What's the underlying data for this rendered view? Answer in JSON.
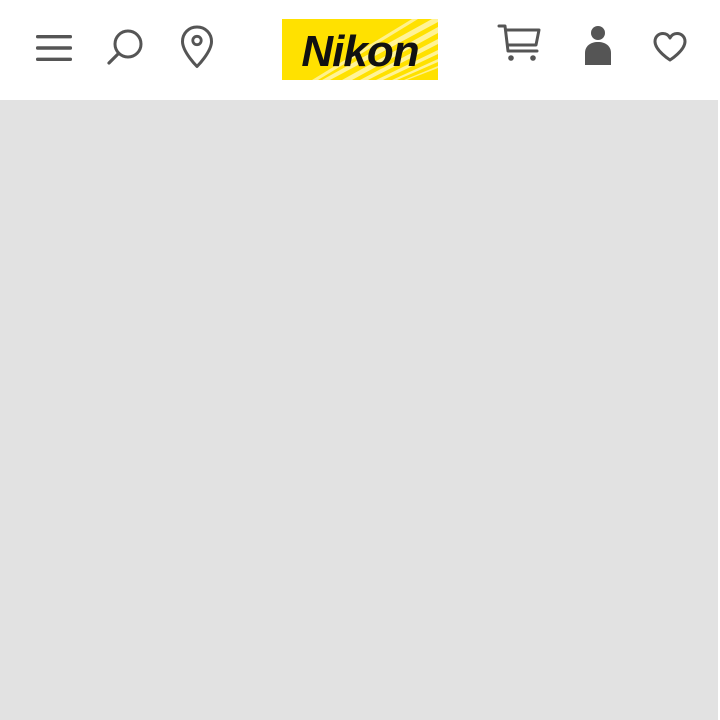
{
  "header": {
    "logo": {
      "text": "Nikon",
      "background_color": "#ffe100",
      "text_color": "#111111"
    },
    "icons": {
      "menu": "menu-icon",
      "search": "search-icon",
      "location": "location-pin-icon",
      "cart": "cart-icon",
      "account": "user-icon",
      "wishlist": "heart-icon"
    },
    "icon_color": "#555555"
  },
  "main": {
    "background_color": "#e2e2e2"
  }
}
